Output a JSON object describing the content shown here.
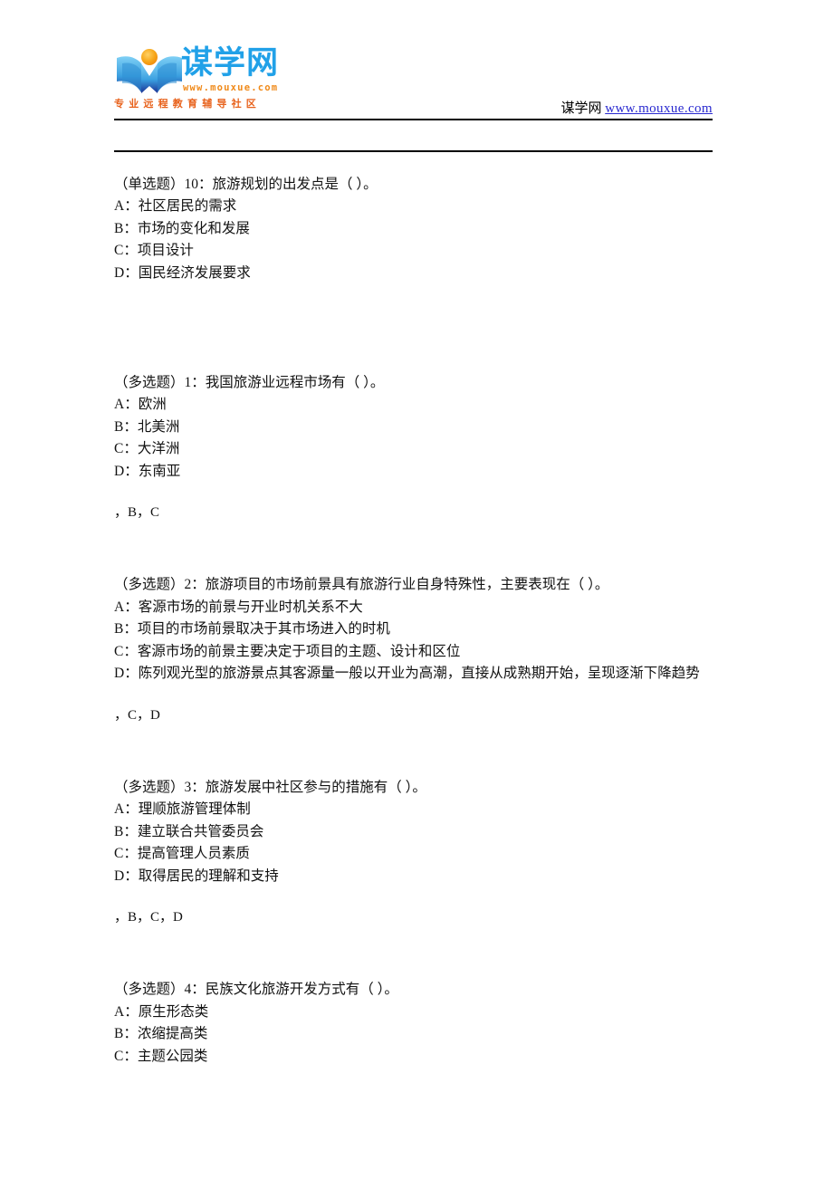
{
  "header": {
    "logo": {
      "wordmark": "谋学网",
      "url_text": "www.mouxue.com",
      "tagline": "专业远程教育辅导社区",
      "mark_name": "mouxue-book-sun-logo",
      "colors": {
        "wordmark_blue": "#21a1e8",
        "mark_blue_dark": "#1b3fa0",
        "mark_blue_light": "#6fc8f2",
        "sun_orange": "#f5a623",
        "tagline_orange": "#e8621c"
      }
    },
    "right_site_name": "谋学网",
    "right_site_link": "www.mouxue.com",
    "link_color": "#2a2ad0"
  },
  "questions": [
    {
      "stem": "（单选题）10：旅游规划的出发点是（  ）。",
      "options": [
        "A：社区居民的需求",
        "B：市场的变化和发展",
        "C：项目设计",
        "D：国民经济发展要求"
      ],
      "answer": ""
    },
    {
      "stem": "（多选题）1：我国旅游业远程市场有（  ）。",
      "options": [
        "A：欧洲",
        "B：北美洲",
        "C：大洋洲",
        "D：东南亚"
      ],
      "answer": "，B，C"
    },
    {
      "stem": "（多选题）2：旅游项目的市场前景具有旅游行业自身特殊性，主要表现在（  ）。",
      "options": [
        "A：客源市场的前景与开业时机关系不大",
        "B：项目的市场前景取决于其市场进入的时机",
        "C：客源市场的前景主要决定于项目的主题、设计和区位",
        "D：陈列观光型的旅游景点其客源量一般以开业为高潮，直接从成熟期开始，呈现逐渐下降趋势"
      ],
      "answer": "，C，D"
    },
    {
      "stem": "（多选题）3：旅游发展中社区参与的措施有（  ）。",
      "options": [
        "A：理顺旅游管理体制",
        "B：建立联合共管委员会",
        "C：提高管理人员素质",
        "D：取得居民的理解和支持"
      ],
      "answer": "，B，C，D"
    },
    {
      "stem": "（多选题）4：民族文化旅游开发方式有（  ）。",
      "options": [
        "A：原生形态类",
        "B：浓缩提高类",
        "C：主题公园类"
      ],
      "answer": ""
    }
  ]
}
